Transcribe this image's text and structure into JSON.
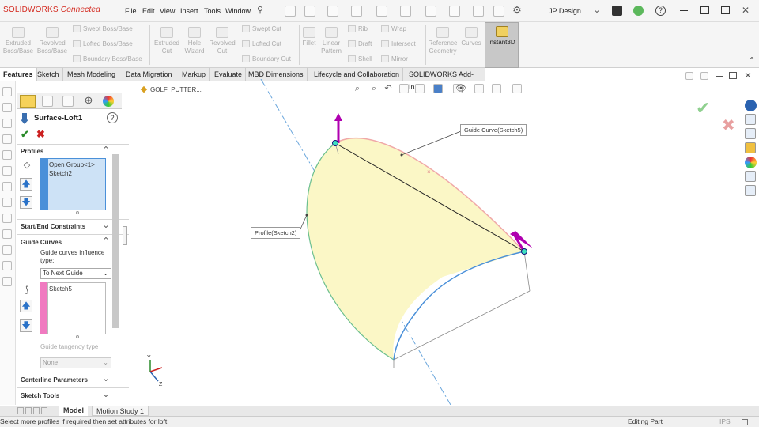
{
  "app": {
    "logo_brand": "SOLIDWORKS",
    "logo_suffix": "Connected",
    "user": "JP Design"
  },
  "menu": [
    "File",
    "Edit",
    "View",
    "Insert",
    "Tools",
    "Window"
  ],
  "ribbon": {
    "buttons": [
      {
        "label": "Extruded\nBoss/Base"
      },
      {
        "label": "Revolved\nBoss/Base"
      },
      {
        "label": "Extruded\nCut"
      },
      {
        "label": "Hole\nWizard"
      },
      {
        "label": "Revolved\nCut"
      },
      {
        "label": "Fillet"
      },
      {
        "label": "Linear\nPattern"
      },
      {
        "label": "Reference\nGeometry"
      },
      {
        "label": "Curves"
      }
    ],
    "small": {
      "swept_boss": "Swept Boss/Base",
      "lofted_boss": "Lofted Boss/Base",
      "boundary_boss": "Boundary Boss/Base",
      "swept_cut": "Swept Cut",
      "lofted_cut": "Lofted Cut",
      "boundary_cut": "Boundary Cut",
      "rib": "Rib",
      "draft": "Draft",
      "shell": "Shell",
      "wrap": "Wrap",
      "intersect": "Intersect",
      "mirror": "Mirror"
    },
    "instant3d": "Instant3D"
  },
  "tabs": [
    "Features",
    "Sketch",
    "Mesh Modeling",
    "Data Migration",
    "Markup",
    "Evaluate",
    "MBD Dimensions",
    "Lifecycle and Collaboration",
    "SOLIDWORKS Add-Ins"
  ],
  "feature_tree_item": "GOLF_PUTTER...",
  "pm": {
    "title": "Surface-Loft1",
    "profiles_header": "Profiles",
    "profiles_items": [
      "Open Group<1>",
      "Sketch2"
    ],
    "start_end_header": "Start/End Constraints",
    "guide_header": "Guide Curves",
    "guide_influence_label": "Guide curves influence type:",
    "guide_influence_value": "To Next Guide",
    "guide_items": [
      "Sketch5"
    ],
    "guide_tangency_label": "Guide tangency type",
    "guide_tangency_value": "None",
    "centerline_header": "Centerline Parameters",
    "sketch_tools_header": "Sketch Tools"
  },
  "callouts": {
    "guide": "Guide Curve(Sketch5)",
    "profile": "Profile(Sketch2)"
  },
  "bottom_tabs": [
    "Model",
    "Motion Study 1"
  ],
  "status": {
    "message": "Select more profiles if required then set attributes for loft",
    "mode": "Editing Part",
    "units": "IPS"
  },
  "colors": {
    "surface_fill": "#fbf7c6",
    "guide_curve": "#f0a8a8",
    "profile_curve": "#4a90d9",
    "handle": "#b000b0",
    "accept": "#2a8a2a",
    "cancel": "#cc2020",
    "profile_marker": "#4a90d9",
    "guide_marker": "#f07ac0"
  }
}
